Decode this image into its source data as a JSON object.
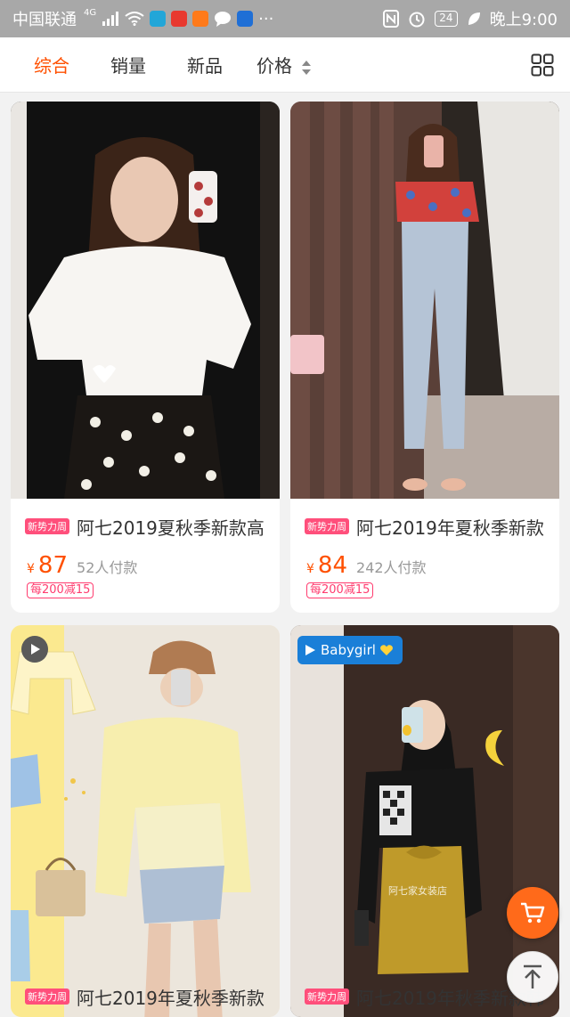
{
  "status_bar": {
    "carrier": "中国联通",
    "network": "4G",
    "more": "···",
    "battery": "24",
    "time": "晚上9:00"
  },
  "filter_bar": {
    "tabs": [
      {
        "label": "综合",
        "active": true
      },
      {
        "label": "销量",
        "active": false
      },
      {
        "label": "新品",
        "active": false
      },
      {
        "label": "价格",
        "active": false
      }
    ]
  },
  "products": [
    {
      "tag": "新势力周",
      "title": "阿七2019夏秋季新款高",
      "currency": "¥",
      "price": "87",
      "paid": "52人付款",
      "coupon": "每200减15"
    },
    {
      "tag": "新势力周",
      "title": "阿七2019年夏秋季新款",
      "currency": "¥",
      "price": "84",
      "paid": "242人付款",
      "coupon": "每200减15"
    },
    {
      "tag": "新势力周",
      "title": "阿七2019年夏秋季新款",
      "video": true
    },
    {
      "tag": "新势力周",
      "title": "阿七2019年秋季新款韩",
      "overlay_label": "Babygirl",
      "watermark": "阿七家女装店"
    }
  ],
  "colors": {
    "accent": "#ff5000",
    "promo_pink": "#ff4f7b",
    "cart_orange": "#ff6a1a",
    "status_bar": "#a8a8a8"
  },
  "icons": {
    "layout_toggle": "grid-view-icon",
    "cart": "cart-icon",
    "back_to_top": "arrow-up-icon"
  }
}
